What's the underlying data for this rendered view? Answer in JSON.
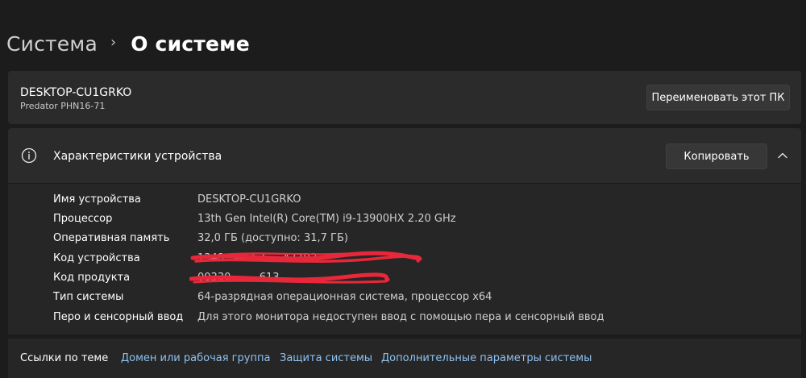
{
  "breadcrumb": {
    "parent": "Система",
    "separator": "›",
    "current": "О системе"
  },
  "device": {
    "name": "DESKTOP-CU1GRKO",
    "model": "Predator PHN16-71",
    "rename_label": "Переименовать этот ПК"
  },
  "specs": {
    "title": "Характеристики устройства",
    "copy_label": "Копировать",
    "rows": [
      {
        "label": "Имя устройства",
        "value": "DESKTOP-CU1GRKO"
      },
      {
        "label": "Процессор",
        "value": "13th Gen Intel(R) Core(TM) i9-13900HX   2.20 GHz"
      },
      {
        "label": "Оперативная память",
        "value": "32,0 ГБ (доступно: 31,7 ГБ)"
      },
      {
        "label": "Код устройства",
        "value": "1348…-4EE3-…-A77B2"
      },
      {
        "label": "Код продукта",
        "value": "00330-…-…613"
      },
      {
        "label": "Тип системы",
        "value": "64-разрядная операционная система, процессор x64"
      },
      {
        "label": "Перо и сенсорный ввод",
        "value": "Для этого монитора недоступен ввод с помощью пера и сенсорный ввод"
      }
    ]
  },
  "related": {
    "title": "Ссылки по теме",
    "links": [
      "Домен или рабочая группа",
      "Защита системы",
      "Дополнительные параметры системы"
    ]
  },
  "colors": {
    "background": "#1c1c1c",
    "card": "#2b2b2b",
    "link": "#8fc1f0",
    "redaction": "#e8283a"
  },
  "icons": {
    "info": "info-icon",
    "collapse": "chevron-up-icon",
    "separator": "chevron-right-icon"
  }
}
